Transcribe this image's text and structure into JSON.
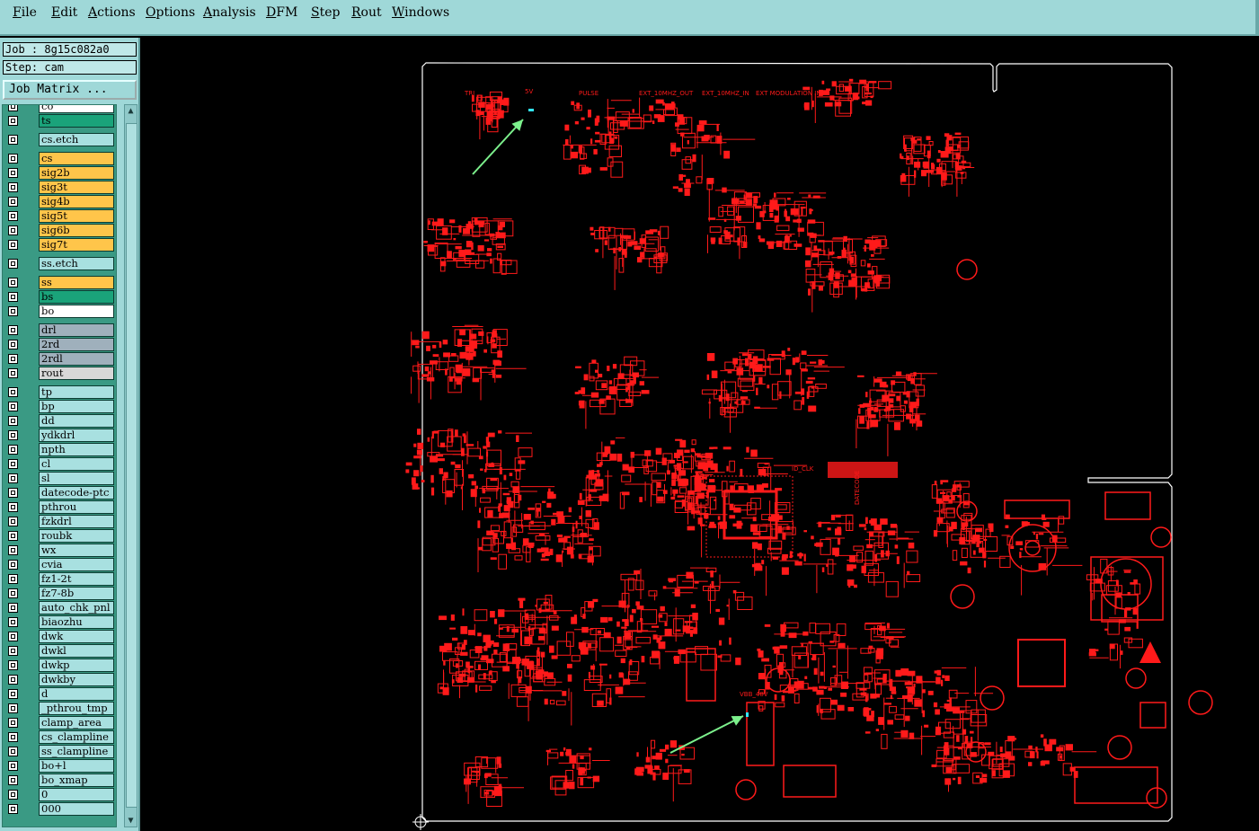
{
  "menubar": {
    "items": [
      {
        "label": "File",
        "ul": "F",
        "rest": "ile"
      },
      {
        "label": "Edit",
        "ul": "E",
        "rest": "dit"
      },
      {
        "label": "Actions",
        "ul": "A",
        "rest": "ctions"
      },
      {
        "label": "Options",
        "ul": "O",
        "rest": "ptions"
      },
      {
        "label": "Analysis",
        "ul": "A",
        "rest": "nalysis"
      },
      {
        "label": "DFM",
        "ul": "D",
        "rest": "FM"
      },
      {
        "label": "Step",
        "ul": "S",
        "rest": "tep"
      },
      {
        "label": "Rout",
        "ul": "R",
        "rest": "out"
      },
      {
        "label": "Windows",
        "ul": "W",
        "rest": "indows"
      }
    ]
  },
  "panel": {
    "job_label": "Job : 8g15c082a0",
    "step_label": "Step: cam",
    "job_matrix_button": "Job Matrix ...",
    "layers": [
      {
        "name": "co",
        "color": "#ffffff"
      },
      {
        "name": "ts",
        "color": "#1aa37a"
      },
      {
        "name": "cs.etch",
        "color": "#a8e0e0"
      },
      {
        "name": "cs",
        "color": "#ffc54a"
      },
      {
        "name": "sig2b",
        "color": "#ffc54a"
      },
      {
        "name": "sig3t",
        "color": "#ffc54a"
      },
      {
        "name": "sig4b",
        "color": "#ffc54a"
      },
      {
        "name": "sig5t",
        "color": "#ffc54a"
      },
      {
        "name": "sig6b",
        "color": "#ffc54a"
      },
      {
        "name": "sig7t",
        "color": "#ffc54a"
      },
      {
        "name": "ss.etch",
        "color": "#a8e0e0"
      },
      {
        "name": "ss",
        "color": "#ffc54a"
      },
      {
        "name": "bs",
        "color": "#1aa37a"
      },
      {
        "name": "bo",
        "color": "#ffffff"
      },
      {
        "name": "drl",
        "color": "#9fb0bc"
      },
      {
        "name": "2rd",
        "color": "#9fb0bc"
      },
      {
        "name": "2rdl",
        "color": "#9fb0bc"
      },
      {
        "name": "rout",
        "color": "#d8d8d8"
      },
      {
        "name": "tp",
        "color": "#a8e0e0"
      },
      {
        "name": "bp",
        "color": "#a8e0e0"
      },
      {
        "name": "dd",
        "color": "#a8e0e0"
      },
      {
        "name": "ydkdrl",
        "color": "#a8e0e0"
      },
      {
        "name": "npth",
        "color": "#a8e0e0"
      },
      {
        "name": "cl",
        "color": "#a8e0e0"
      },
      {
        "name": "sl",
        "color": "#a8e0e0"
      },
      {
        "name": "datecode-ptc",
        "color": "#a8e0e0"
      },
      {
        "name": "pthrou",
        "color": "#a8e0e0"
      },
      {
        "name": "fzkdrl",
        "color": "#a8e0e0"
      },
      {
        "name": "roubk",
        "color": "#a8e0e0"
      },
      {
        "name": "wx",
        "color": "#a8e0e0"
      },
      {
        "name": "cvia",
        "color": "#a8e0e0"
      },
      {
        "name": "fz1-2t",
        "color": "#a8e0e0"
      },
      {
        "name": "fz7-8b",
        "color": "#a8e0e0"
      },
      {
        "name": "auto_chk_pnl",
        "color": "#a8e0e0"
      },
      {
        "name": "biaozhu",
        "color": "#a8e0e0"
      },
      {
        "name": "dwk",
        "color": "#a8e0e0"
      },
      {
        "name": "dwkl",
        "color": "#a8e0e0"
      },
      {
        "name": "dwkp",
        "color": "#a8e0e0"
      },
      {
        "name": "dwkby",
        "color": "#a8e0e0"
      },
      {
        "name": "d",
        "color": "#a8e0e0"
      },
      {
        "name": "_pthrou_tmp",
        "color": "#a8e0e0"
      },
      {
        "name": "clamp_area",
        "color": "#a8e0e0"
      },
      {
        "name": "cs_clampline",
        "color": "#a8e0e0"
      },
      {
        "name": "ss_clampline",
        "color": "#a8e0e0"
      },
      {
        "name": "bo+l",
        "color": "#a8e0e0"
      },
      {
        "name": "bo_xmap",
        "color": "#a8e0e0"
      },
      {
        "name": "0",
        "color": "#a8e0e0"
      },
      {
        "name": "000",
        "color": "#a8e0e0"
      }
    ]
  },
  "board": {
    "labels": [
      "TRI",
      "5V",
      "PULSE",
      "EXT_10MHZ_OUT",
      "EXT_10MHZ_IN",
      "EXT MODULATION IN",
      "ID_CLK",
      "VBB_48V",
      "DATECODE"
    ],
    "colors": {
      "trace": "#ff1a1a",
      "outline": "#ffffff",
      "arrow": "#7cf08c",
      "highlight": "#33e6ff"
    }
  }
}
